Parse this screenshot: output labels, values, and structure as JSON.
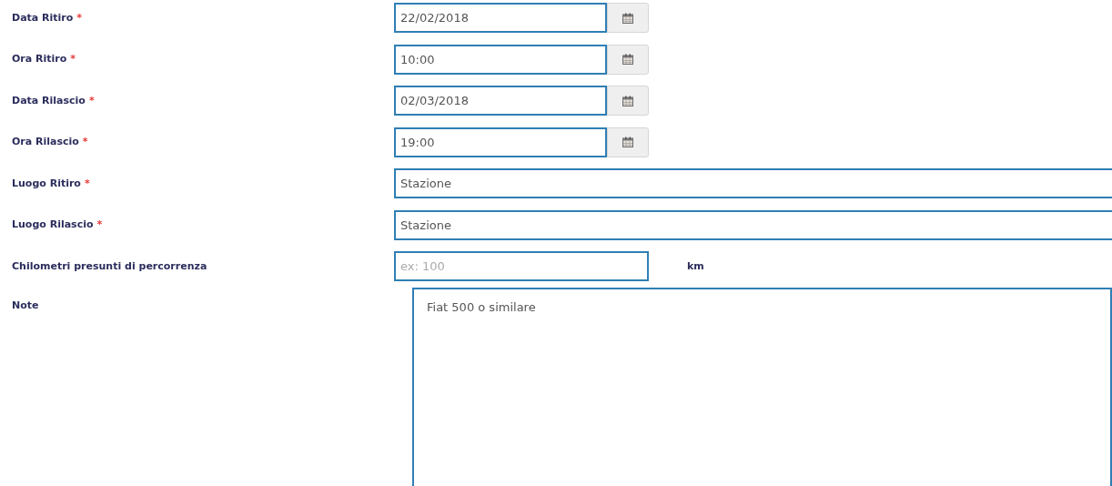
{
  "fields": [
    {
      "kind": "picker",
      "label": "Data Ritiro",
      "required_mark": "*",
      "value": "22/02/2018"
    },
    {
      "kind": "picker",
      "label": "Ora Ritiro",
      "required_mark": "*",
      "value": "10:00"
    },
    {
      "kind": "picker",
      "label": "Data Rilascio",
      "required_mark": "*",
      "value": "02/03/2018"
    },
    {
      "kind": "picker",
      "label": "Ora Rilascio",
      "required_mark": "*",
      "value": "19:00"
    },
    {
      "kind": "text",
      "label": "Luogo Ritiro",
      "required_mark": "*",
      "value": "Stazione"
    },
    {
      "kind": "text",
      "label": "Luogo Rilascio",
      "required_mark": "*",
      "value": "Stazione"
    },
    {
      "kind": "unit",
      "label": "Chilometri presunti di percorrenza",
      "placeholder": "ex: 100",
      "unit": "km"
    },
    {
      "kind": "textarea",
      "label": "Note",
      "value": "Fiat 500 o similare"
    }
  ]
}
